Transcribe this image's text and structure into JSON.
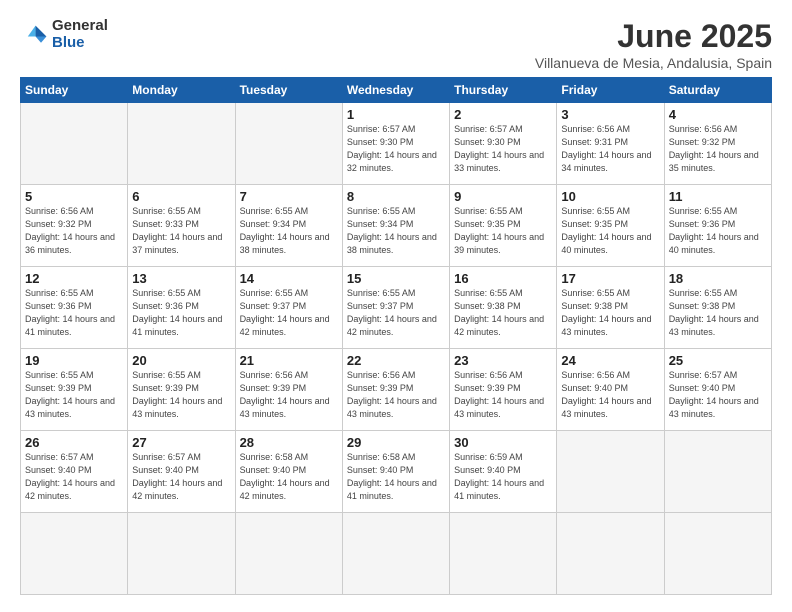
{
  "logo": {
    "general": "General",
    "blue": "Blue"
  },
  "title": "June 2025",
  "subtitle": "Villanueva de Mesia, Andalusia, Spain",
  "weekdays": [
    "Sunday",
    "Monday",
    "Tuesday",
    "Wednesday",
    "Thursday",
    "Friday",
    "Saturday"
  ],
  "days": [
    {
      "num": "",
      "info": ""
    },
    {
      "num": "",
      "info": ""
    },
    {
      "num": "",
      "info": ""
    },
    {
      "num": "1",
      "info": "Sunrise: 6:57 AM\nSunset: 9:30 PM\nDaylight: 14 hours and 32 minutes."
    },
    {
      "num": "2",
      "info": "Sunrise: 6:57 AM\nSunset: 9:30 PM\nDaylight: 14 hours and 33 minutes."
    },
    {
      "num": "3",
      "info": "Sunrise: 6:56 AM\nSunset: 9:31 PM\nDaylight: 14 hours and 34 minutes."
    },
    {
      "num": "4",
      "info": "Sunrise: 6:56 AM\nSunset: 9:32 PM\nDaylight: 14 hours and 35 minutes."
    },
    {
      "num": "5",
      "info": "Sunrise: 6:56 AM\nSunset: 9:32 PM\nDaylight: 14 hours and 36 minutes."
    },
    {
      "num": "6",
      "info": "Sunrise: 6:55 AM\nSunset: 9:33 PM\nDaylight: 14 hours and 37 minutes."
    },
    {
      "num": "7",
      "info": "Sunrise: 6:55 AM\nSunset: 9:34 PM\nDaylight: 14 hours and 38 minutes."
    },
    {
      "num": "8",
      "info": "Sunrise: 6:55 AM\nSunset: 9:34 PM\nDaylight: 14 hours and 38 minutes."
    },
    {
      "num": "9",
      "info": "Sunrise: 6:55 AM\nSunset: 9:35 PM\nDaylight: 14 hours and 39 minutes."
    },
    {
      "num": "10",
      "info": "Sunrise: 6:55 AM\nSunset: 9:35 PM\nDaylight: 14 hours and 40 minutes."
    },
    {
      "num": "11",
      "info": "Sunrise: 6:55 AM\nSunset: 9:36 PM\nDaylight: 14 hours and 40 minutes."
    },
    {
      "num": "12",
      "info": "Sunrise: 6:55 AM\nSunset: 9:36 PM\nDaylight: 14 hours and 41 minutes."
    },
    {
      "num": "13",
      "info": "Sunrise: 6:55 AM\nSunset: 9:36 PM\nDaylight: 14 hours and 41 minutes."
    },
    {
      "num": "14",
      "info": "Sunrise: 6:55 AM\nSunset: 9:37 PM\nDaylight: 14 hours and 42 minutes."
    },
    {
      "num": "15",
      "info": "Sunrise: 6:55 AM\nSunset: 9:37 PM\nDaylight: 14 hours and 42 minutes."
    },
    {
      "num": "16",
      "info": "Sunrise: 6:55 AM\nSunset: 9:38 PM\nDaylight: 14 hours and 42 minutes."
    },
    {
      "num": "17",
      "info": "Sunrise: 6:55 AM\nSunset: 9:38 PM\nDaylight: 14 hours and 43 minutes."
    },
    {
      "num": "18",
      "info": "Sunrise: 6:55 AM\nSunset: 9:38 PM\nDaylight: 14 hours and 43 minutes."
    },
    {
      "num": "19",
      "info": "Sunrise: 6:55 AM\nSunset: 9:39 PM\nDaylight: 14 hours and 43 minutes."
    },
    {
      "num": "20",
      "info": "Sunrise: 6:55 AM\nSunset: 9:39 PM\nDaylight: 14 hours and 43 minutes."
    },
    {
      "num": "21",
      "info": "Sunrise: 6:56 AM\nSunset: 9:39 PM\nDaylight: 14 hours and 43 minutes."
    },
    {
      "num": "22",
      "info": "Sunrise: 6:56 AM\nSunset: 9:39 PM\nDaylight: 14 hours and 43 minutes."
    },
    {
      "num": "23",
      "info": "Sunrise: 6:56 AM\nSunset: 9:39 PM\nDaylight: 14 hours and 43 minutes."
    },
    {
      "num": "24",
      "info": "Sunrise: 6:56 AM\nSunset: 9:40 PM\nDaylight: 14 hours and 43 minutes."
    },
    {
      "num": "25",
      "info": "Sunrise: 6:57 AM\nSunset: 9:40 PM\nDaylight: 14 hours and 43 minutes."
    },
    {
      "num": "26",
      "info": "Sunrise: 6:57 AM\nSunset: 9:40 PM\nDaylight: 14 hours and 42 minutes."
    },
    {
      "num": "27",
      "info": "Sunrise: 6:57 AM\nSunset: 9:40 PM\nDaylight: 14 hours and 42 minutes."
    },
    {
      "num": "28",
      "info": "Sunrise: 6:58 AM\nSunset: 9:40 PM\nDaylight: 14 hours and 42 minutes."
    },
    {
      "num": "29",
      "info": "Sunrise: 6:58 AM\nSunset: 9:40 PM\nDaylight: 14 hours and 41 minutes."
    },
    {
      "num": "30",
      "info": "Sunrise: 6:59 AM\nSunset: 9:40 PM\nDaylight: 14 hours and 41 minutes."
    },
    {
      "num": "",
      "info": ""
    },
    {
      "num": "",
      "info": ""
    },
    {
      "num": "",
      "info": ""
    },
    {
      "num": "",
      "info": ""
    },
    {
      "num": "",
      "info": ""
    }
  ]
}
